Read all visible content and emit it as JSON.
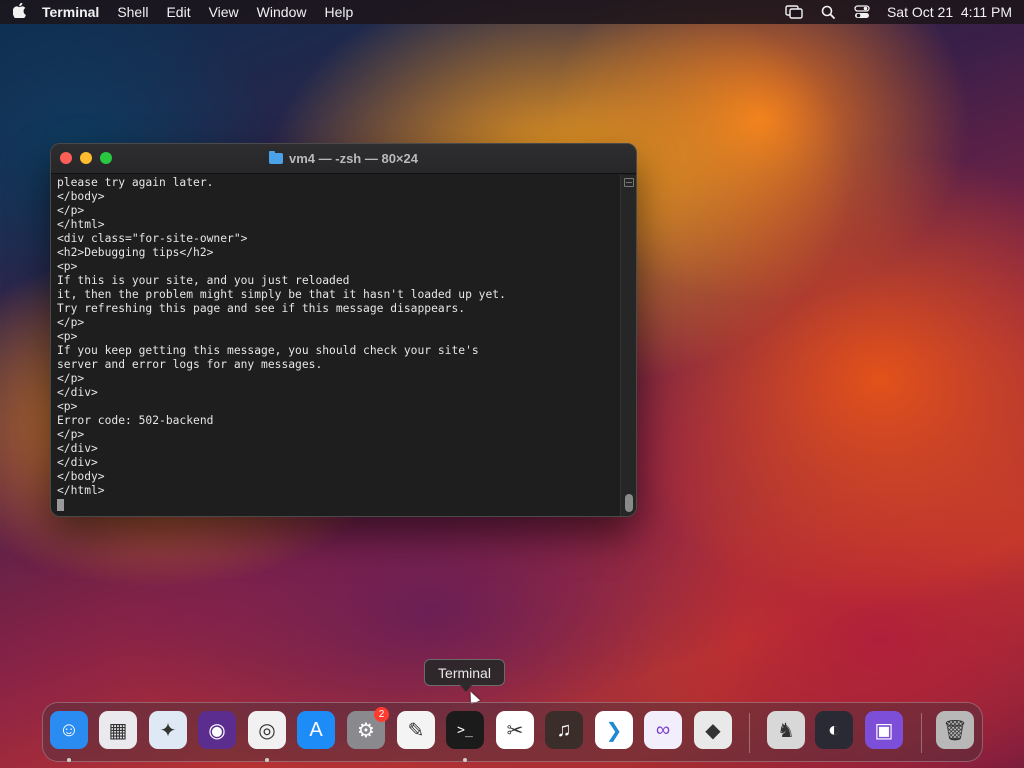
{
  "menubar": {
    "apple_icon": "apple-icon",
    "app_name": "Terminal",
    "items": [
      "Shell",
      "Edit",
      "View",
      "Window",
      "Help"
    ],
    "status_icons": [
      "screen-mirroring-icon",
      "search-icon",
      "control-center-icon"
    ],
    "datetime": "Sat Oct 21  4:11 PM"
  },
  "terminal": {
    "title": "vm4 — -zsh — 80×24",
    "lines": [
      "please try again later.",
      "</body>",
      "</p>",
      "</html>",
      "<div class=\"for-site-owner\">",
      "<h2>Debugging tips</h2>",
      "<p>",
      "If this is your site, and you just reloaded",
      "it, then the problem might simply be that it hasn't loaded up yet.",
      "Try refreshing this page and see if this message disappears.",
      "</p>",
      "<p>",
      "If you keep getting this message, you should check your site's",
      "server and error logs for any messages.",
      "</p>",
      "</div>",
      "<p>",
      "Error code: 502-backend",
      "</p>",
      "</div>",
      "</div>",
      "</body>",
      "</html>"
    ]
  },
  "tooltip": {
    "text": "Terminal"
  },
  "dock": {
    "apps": [
      {
        "name": "finder",
        "bg": "#2a8cf0",
        "glyph": "☺",
        "running": true
      },
      {
        "name": "launchpad",
        "bg": "#e9e9ee",
        "glyph": "▦",
        "running": false
      },
      {
        "name": "safari",
        "bg": "#dfe9f5",
        "glyph": "✦",
        "running": false
      },
      {
        "name": "firefox",
        "bg": "#5b2d8f",
        "glyph": "◉",
        "running": false
      },
      {
        "name": "chrome",
        "bg": "#f1f1f1",
        "glyph": "◎",
        "running": true
      },
      {
        "name": "app-store",
        "bg": "#1d8cf7",
        "glyph": "A",
        "running": false
      },
      {
        "name": "system-settings",
        "bg": "#8a8a8e",
        "glyph": "⚙",
        "running": false,
        "badge": "2"
      },
      {
        "name": "textedit",
        "bg": "#f4f4f4",
        "glyph": "✎",
        "running": false
      },
      {
        "name": "terminal",
        "bg": "#1b1b1b",
        "glyph": ">_",
        "running": true
      },
      {
        "name": "capcut",
        "bg": "#ffffff",
        "glyph": "✂",
        "running": false
      },
      {
        "name": "garageband",
        "bg": "#3b2e2a",
        "glyph": "♫",
        "running": false
      },
      {
        "name": "vscode",
        "bg": "#ffffff",
        "glyph": "❯",
        "running": false
      },
      {
        "name": "visual-studio",
        "bg": "#f2eefb",
        "glyph": "∞",
        "running": false
      },
      {
        "name": "roblox",
        "bg": "#e9e9e9",
        "glyph": "◆",
        "running": false
      },
      {
        "name": "chess",
        "bg": "#d8d8d8",
        "glyph": "♞",
        "running": false
      },
      {
        "name": "obs",
        "bg": "#2a2a35",
        "glyph": "◐",
        "running": false
      },
      {
        "name": "apple-configurator",
        "bg": "#7d4fd8",
        "glyph": "▣",
        "running": false
      },
      {
        "name": "trash",
        "bg": "#b8b8b8",
        "glyph": "🗑",
        "running": false
      }
    ]
  }
}
